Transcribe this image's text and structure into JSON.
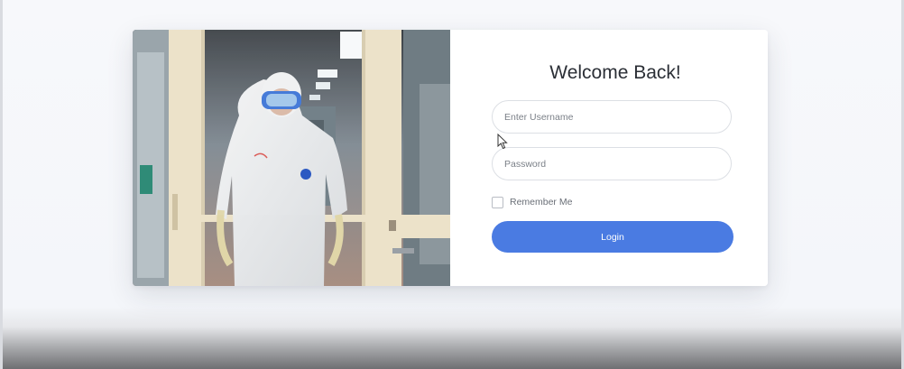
{
  "login_form": {
    "title": "Welcome Back!",
    "username_placeholder": "Enter Username",
    "password_placeholder": "Password",
    "remember_label": "Remember Me",
    "login_label": "Login"
  },
  "colors": {
    "primary": "#4a7be2",
    "background": "#f4f6fa",
    "card": "#ffffff",
    "title_text": "#2b2f36"
  },
  "icons": {
    "cursor": "mouse-pointer-icon"
  }
}
